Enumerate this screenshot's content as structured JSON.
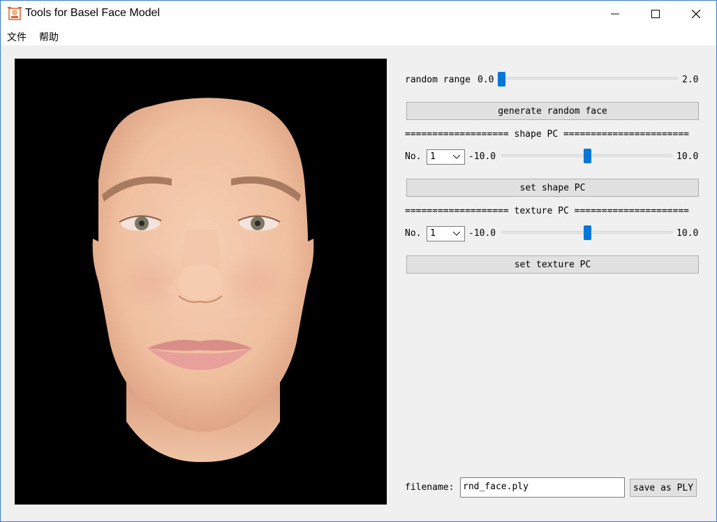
{
  "window": {
    "title": "Tools for Basel Face Model",
    "icon": "app-icon",
    "controls": [
      "minimize-icon",
      "maximize-icon",
      "close-icon"
    ]
  },
  "menu": {
    "file": "文件",
    "help": "帮助"
  },
  "viewport": {
    "background": "#000000"
  },
  "random": {
    "label": "random range",
    "min": "0.0",
    "max": "2.0",
    "value_fraction": 0.0,
    "button": "generate random face"
  },
  "shape": {
    "separator": "=================== shape PC =======================",
    "no_label": "No.",
    "selected": "1",
    "min": "-10.0",
    "max": "10.0",
    "value_fraction": 0.5,
    "button": "set shape PC"
  },
  "texture": {
    "separator": "=================== texture PC =====================",
    "no_label": "No.",
    "selected": "1",
    "min": "-10.0",
    "max": "10.0",
    "value_fraction": 0.5,
    "button": "set texture PC"
  },
  "save": {
    "label": "filename:",
    "value": "rnd_face.ply",
    "button": "save as PLY"
  },
  "colors": {
    "accent": "#0078d7",
    "panel": "#f0f0f0",
    "button": "#e1e1e1"
  }
}
